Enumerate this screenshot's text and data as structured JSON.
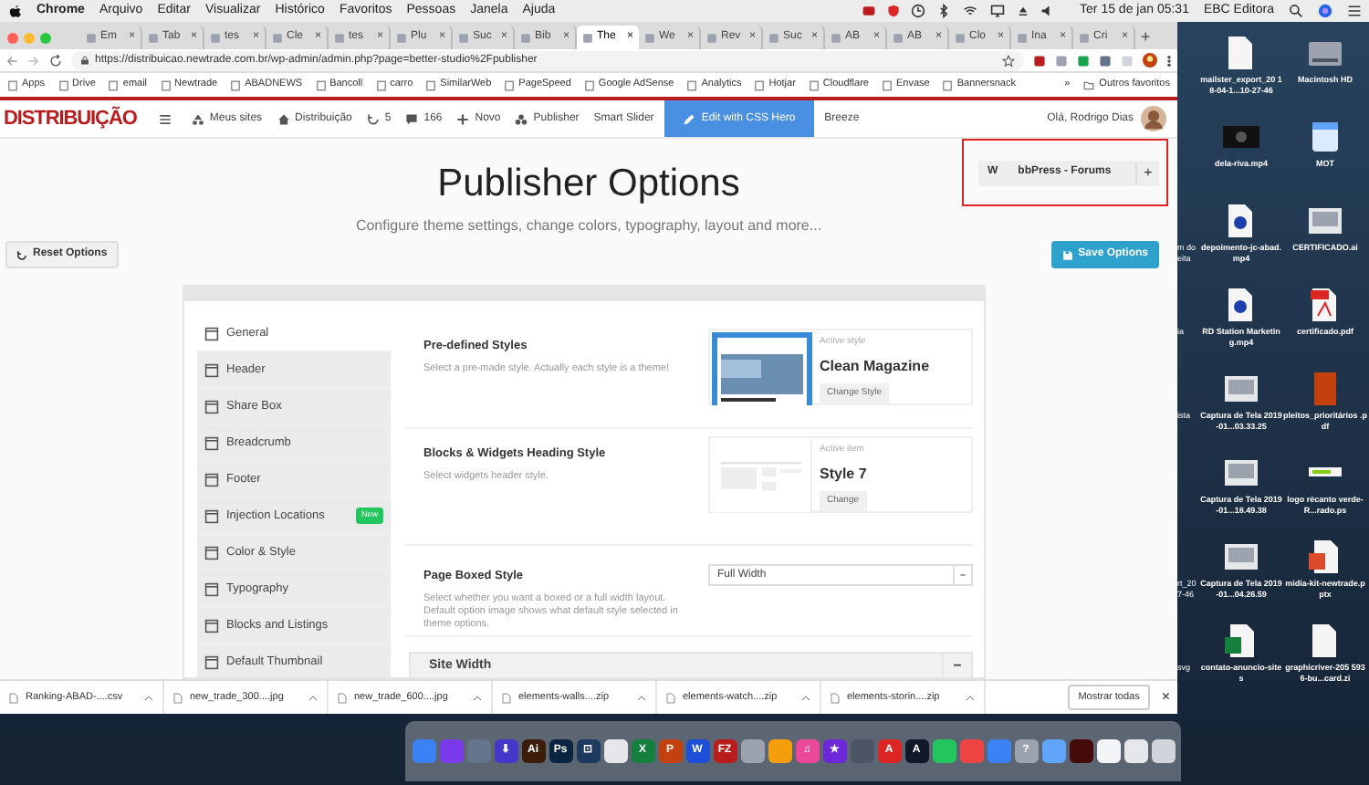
{
  "menu_bar": {
    "app": "Chrome",
    "items": [
      "Arquivo",
      "Editar",
      "Visualizar",
      "Histórico",
      "Favoritos",
      "Pessoas",
      "Janela",
      "Ajuda"
    ],
    "clock": "Ter 15 de jan  05:31",
    "user": "EBC Editora"
  },
  "tabs": [
    {
      "label": "Em",
      "selected": false
    },
    {
      "label": "Tab",
      "selected": false
    },
    {
      "label": "tes",
      "selected": false
    },
    {
      "label": "Cle",
      "selected": false
    },
    {
      "label": "tes",
      "selected": false
    },
    {
      "label": "Plu",
      "selected": false
    },
    {
      "label": "Suc",
      "selected": false
    },
    {
      "label": "Bib",
      "selected": false
    },
    {
      "label": "The",
      "selected": true
    },
    {
      "label": "We",
      "selected": false
    },
    {
      "label": "Rev",
      "selected": false
    },
    {
      "label": "Suc",
      "selected": false
    },
    {
      "label": "AB",
      "selected": false
    },
    {
      "label": "AB",
      "selected": false
    },
    {
      "label": "Clo",
      "selected": false
    },
    {
      "label": "Ina",
      "selected": false
    },
    {
      "label": "Cri",
      "selected": false
    }
  ],
  "tab_close": "×",
  "new_tab": "+",
  "address_bar": {
    "url": "https://distribuicao.newtrade.com.br/wp-admin/admin.php?page=better-studio%2Fpublisher"
  },
  "bookmarks": {
    "items": [
      "Apps",
      "Drive",
      "email",
      "Newtrade",
      "ABADNEWS",
      "Bancoll",
      "carro",
      "SimilarWeb",
      "PageSpeed",
      "Google AdSense",
      "Analytics",
      "Hotjar",
      "Cloudflare",
      "Envase",
      "Bannersnack"
    ],
    "more": "»",
    "other": "Outros favoritos"
  },
  "admin_bar": {
    "logo": "DISTRIBUIÇÃO",
    "items": [
      {
        "kind": "sites",
        "label": "Meus sites"
      },
      {
        "kind": "home",
        "label": "Distribuição"
      },
      {
        "kind": "updates",
        "label": "5"
      },
      {
        "kind": "comments",
        "label": "166"
      },
      {
        "kind": "new",
        "label": "Novo"
      },
      {
        "kind": "publisher",
        "label": "Publisher"
      },
      {
        "kind": "plain",
        "label": "Smart Slider"
      },
      {
        "kind": "highlight",
        "label": "Edit with CSS Hero"
      },
      {
        "kind": "plain",
        "label": "Breeze"
      }
    ],
    "greeting": "Olá, Rodrigo Dias"
  },
  "page": {
    "title": "Publisher Options",
    "subtitle": "Configure theme settings, change colors, typography, layout and more...",
    "reset_button": "Reset Options",
    "save_button": "Save Options"
  },
  "highlight_box": {
    "tab": "W",
    "label": "bbPress - Forums",
    "add": "+"
  },
  "sidebar": {
    "items": [
      {
        "label": "General",
        "selected": true
      },
      {
        "label": "Header",
        "selected": false
      },
      {
        "label": "Share Box",
        "selected": false
      },
      {
        "label": "Breadcrumb",
        "selected": false
      },
      {
        "label": "Footer",
        "selected": false
      },
      {
        "label": "Injection Locations",
        "selected": false,
        "badge": "New"
      },
      {
        "label": "Color & Style",
        "selected": false
      },
      {
        "label": "Typography",
        "selected": false
      },
      {
        "label": "Blocks and Listings",
        "selected": false
      },
      {
        "label": "Default Thumbnail",
        "selected": false
      }
    ]
  },
  "settings": [
    {
      "kind": "style_picker",
      "title": "Pre-defined Styles",
      "description": "Select a pre-made style. Actually each style is a theme!",
      "caption": "Active style",
      "value": "Clean Magazine",
      "button": "Change Style"
    },
    {
      "kind": "heading_picker",
      "title": "Blocks & Widgets Heading Style",
      "description": "Select widgets header style.",
      "caption": "Active item",
      "value": "Style 7",
      "button": "Change"
    },
    {
      "kind": "select",
      "title": "Page Boxed Style",
      "description": "Select whether you want a boxed or a full width layout. Default option image shows what default style selected in theme options.",
      "value": "Full Width"
    }
  ],
  "section": {
    "title": "Site Width",
    "toggle": "−"
  },
  "downloads": {
    "items": [
      "Ranking-ABAD-....csv",
      "new_trade_300....jpg",
      "new_trade_600....jpg",
      "elements-walls....zip",
      "elements-watch....zip",
      "elements-storin....zip"
    ],
    "show_all": "Mostrar todas",
    "close": "×"
  },
  "desktop": {
    "rows": [
      {
        "icons": [
          {
            "kind": "document",
            "label": "mailster_export_20 18-04-1...10-27-46"
          },
          {
            "kind": "drive",
            "label": "Macintosh HD"
          }
        ]
      },
      {
        "icons": [
          {
            "kind": "video",
            "label": "dela-riva.mp4"
          },
          {
            "kind": "app",
            "label": "MOT"
          }
        ]
      },
      {
        "partial": "m do eita",
        "icons": [
          {
            "kind": "movie",
            "label": "depoimento-jc-abad.mp4"
          },
          {
            "kind": "image",
            "label": "CERTIFICADO.ai"
          }
        ]
      },
      {
        "partial": "ia",
        "icons": [
          {
            "kind": "movie",
            "label": "RD Station Marketing.mp4"
          },
          {
            "kind": "pdf",
            "label": "certificado.pdf"
          }
        ]
      },
      {
        "partial": "ista",
        "icons": [
          {
            "kind": "image",
            "label": "Captura de Tela 2019-01...03.33.25"
          },
          {
            "kind": "book",
            "label": "pleitos_prioritários .pdf"
          }
        ]
      },
      {
        "icons": [
          {
            "kind": "image",
            "label": "Captura de Tela 2019-01...18.49.38"
          },
          {
            "kind": "banner",
            "label": "logo rècanto verde-R...rado.ps"
          }
        ]
      },
      {
        "partial": "rt_20 7-46",
        "icons": [
          {
            "kind": "image",
            "label": "Captura de Tela 2019-01...04.26.59"
          },
          {
            "kind": "ppt",
            "label": "midia-kit-newtrade.pptx"
          }
        ]
      },
      {
        "partial": "svg",
        "icons": [
          {
            "kind": "xls",
            "label": "contato-anuncio-sites"
          },
          {
            "kind": "document",
            "label": "graphicriver-205 5936-bu...card.zi"
          }
        ]
      }
    ]
  },
  "dock": [
    {
      "color": "#3b82f6"
    },
    {
      "color": "#7c3aed"
    },
    {
      "color": "#64748b"
    },
    {
      "color": "#4338ca",
      "glyph": "⬇"
    },
    {
      "color": "#3b1d0a",
      "glyph": "Ai"
    },
    {
      "color": "#0b2440",
      "glyph": "Ps"
    },
    {
      "color": "#1e3a5f",
      "glyph": "⊡"
    },
    {
      "color": "#e5e7eb"
    },
    {
      "color": "#15803d",
      "glyph": "X"
    },
    {
      "color": "#c2410c",
      "glyph": "P"
    },
    {
      "color": "#1d4ed8",
      "glyph": "W"
    },
    {
      "color": "#b91c1c",
      "glyph": "FZ"
    },
    {
      "color": "#9ca3af"
    },
    {
      "color": "#f59e0b"
    },
    {
      "color": "#ec4899",
      "glyph": "♫"
    },
    {
      "color": "#6d28d9",
      "glyph": "★"
    },
    {
      "color": "#4b5563"
    },
    {
      "color": "#dc2626",
      "glyph": "A"
    },
    {
      "color": "#111827",
      "glyph": "A"
    },
    {
      "color": "#22c55e"
    },
    {
      "color": "#ef4444"
    },
    {
      "color": "#3b82f6"
    },
    {
      "color": "#9ca3af",
      "glyph": "?"
    },
    {
      "color": "#60a5fa"
    },
    {
      "color": "#450a0a"
    },
    {
      "color": "#f3f4f6"
    },
    {
      "color": "#e5e7eb"
    },
    {
      "color": "#d1d5db"
    }
  ]
}
